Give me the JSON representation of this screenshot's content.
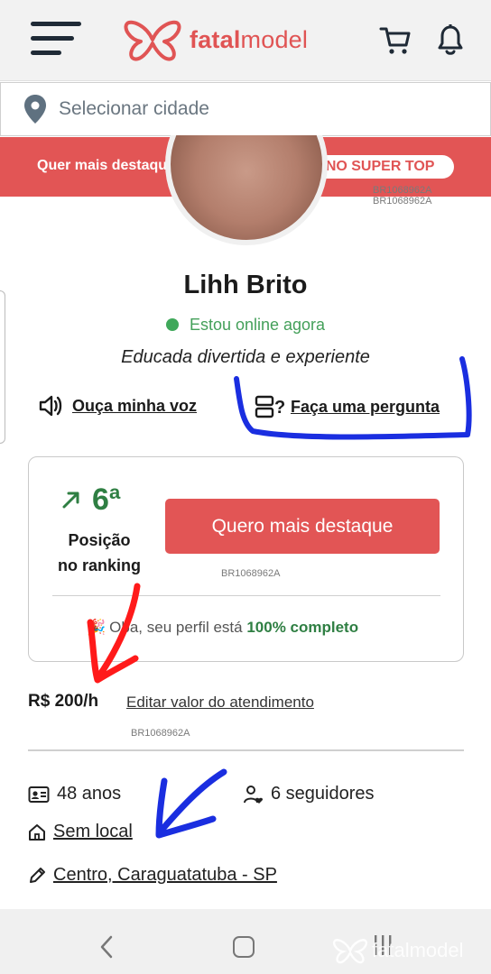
{
  "header": {
    "logo_text_bold": "fatal",
    "logo_text_rest": "model"
  },
  "city": {
    "placeholder": "Selecionar cidade"
  },
  "promo": {
    "text": "Quer mais destaque?",
    "button": "ATIVE O PLANO SUPER TOP"
  },
  "watermark_id": "BR1068962A",
  "profile": {
    "name": "Lihh Brito",
    "status": "Estou online agora",
    "tagline": "Educada divertida e experiente",
    "voice_link": "Ouça minha voz",
    "ask_link": "Faça uma pergunta"
  },
  "ranking": {
    "position": "6ª",
    "label_line1": "Posição",
    "label_line2": "no ranking",
    "cta": "Quero mais destaque",
    "complete_emoji": "🎉",
    "complete_prefix": "Oba, seu perfil está",
    "complete_value": "100% completo"
  },
  "pricing": {
    "price": "R$ 200/h",
    "edit_link": "Editar valor do atendimento"
  },
  "details": {
    "age": "48 anos",
    "followers": "6 seguidores",
    "location_type": "Sem local",
    "address": "Centro, Caraguatatuba - SP"
  },
  "colors": {
    "brand": "#e25555",
    "success": "#2f7f43",
    "online": "#3fa85a"
  },
  "navbar_watermark": "fatalmodel"
}
